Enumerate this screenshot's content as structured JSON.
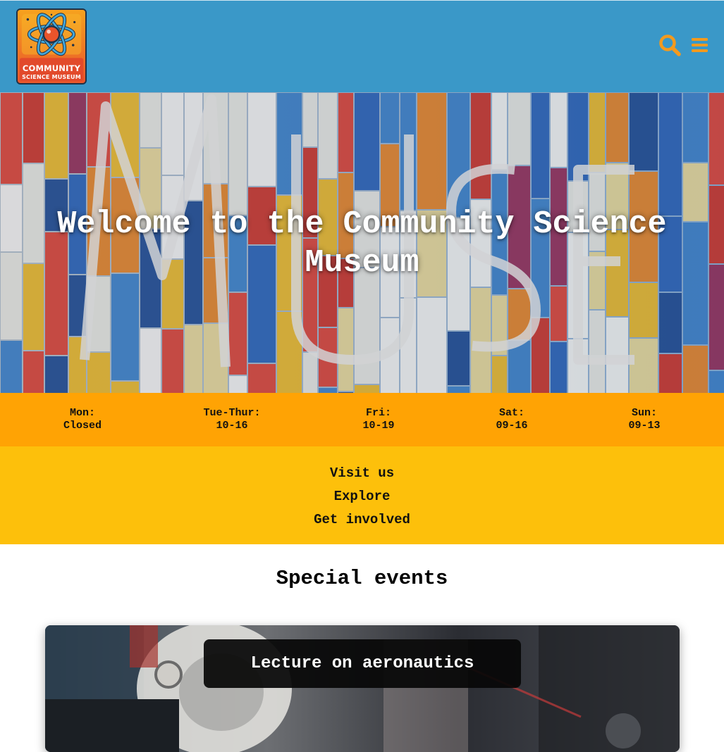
{
  "header": {
    "logo": {
      "line1": "COMMUNITY",
      "line2": "SCIENCE MUSEUM"
    },
    "icons": [
      "search-icon",
      "menu-icon"
    ],
    "background_color": "#3a98c8",
    "icon_color": "#f39a1e"
  },
  "hero": {
    "title": "Welcome to the Community Science Museum"
  },
  "hours": [
    {
      "day": "Mon:",
      "time": "Closed"
    },
    {
      "day": "Tue-Thur:",
      "time": "10-16"
    },
    {
      "day": "Fri:",
      "time": "10-19"
    },
    {
      "day": "Sat:",
      "time": "09-16"
    },
    {
      "day": "Sun:",
      "time": "09-13"
    }
  ],
  "nav": {
    "links": [
      "Visit us",
      "Explore",
      "Get involved"
    ]
  },
  "events": {
    "title": "Special events",
    "cards": [
      {
        "label": "Lecture on aeronautics"
      }
    ]
  },
  "colors": {
    "hours_bar": "#ffa304",
    "nav_bar": "#fdc00b"
  }
}
